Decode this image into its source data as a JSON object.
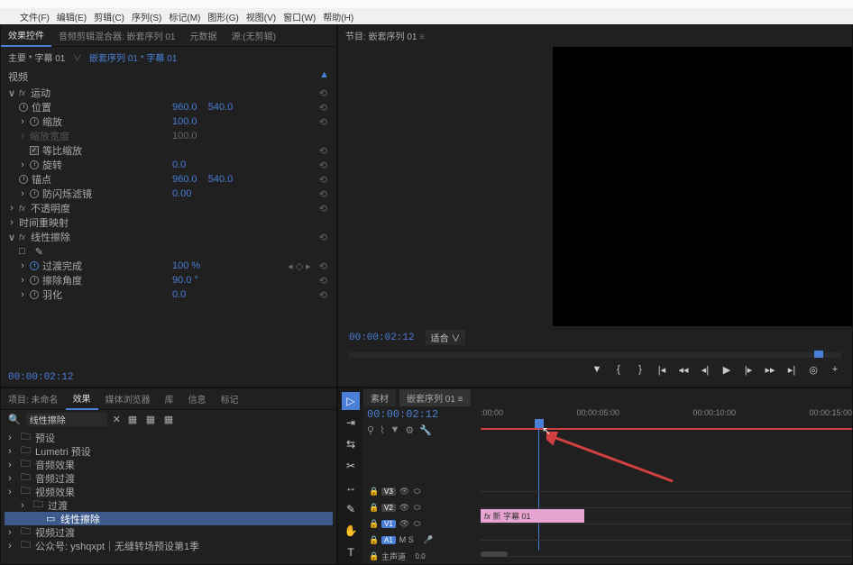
{
  "menu": [
    "文件(F)",
    "编辑(E)",
    "剪辑(C)",
    "序列(S)",
    "标记(M)",
    "图形(G)",
    "视图(V)",
    "窗口(W)",
    "帮助(H)"
  ],
  "effectControls": {
    "tabs": [
      "效果控件",
      "音频剪辑混合器: 嵌套序列 01",
      "元数据",
      "源:(无剪辑)"
    ],
    "activeTab": 0,
    "breadcrumb_main": "主要",
    "breadcrumb_clip": "字幕 01",
    "breadcrumb_seq": "嵌套序列 01 * 字幕 01",
    "header_video": "视频",
    "motion": {
      "label": "运动",
      "position": {
        "label": "位置",
        "x": "960.0",
        "y": "540.0"
      },
      "scale": {
        "label": "缩放",
        "value": "100.0"
      },
      "scaleW": {
        "label": "缩放宽度",
        "value": "100.0"
      },
      "uniform": {
        "label": "等比缩放",
        "checked": true
      },
      "rotation": {
        "label": "旋转",
        "value": "0.0"
      },
      "anchor": {
        "label": "锚点",
        "x": "960.0",
        "y": "540.0"
      },
      "antiflicker": {
        "label": "防闪烁滤镜",
        "value": "0.00"
      }
    },
    "opacity": {
      "label": "不透明度"
    },
    "timeremap": {
      "label": "时间重映射"
    },
    "linearWipe": {
      "label": "线性擦除",
      "box_icon": "□",
      "completion": {
        "label": "过渡完成",
        "value": "100 %"
      },
      "angle": {
        "label": "擦除角度",
        "value": "90.0 °"
      },
      "feather": {
        "label": "羽化",
        "value": "0.0"
      }
    },
    "timecode": "00:00:02:12"
  },
  "program": {
    "title": "节目: 嵌套序列 01",
    "timecode": "00:00:02:12",
    "fit": "适合"
  },
  "project": {
    "tabs": [
      "项目: 未命名",
      "效果",
      "媒体浏览器",
      "库",
      "信息",
      "标记"
    ],
    "activeTab": 1,
    "searchPlaceholder": "线性擦除",
    "folders": [
      {
        "icon": "folder",
        "label": "预设",
        "indent": 0
      },
      {
        "icon": "folder",
        "label": "Lumetri 预设",
        "indent": 0
      },
      {
        "icon": "folder",
        "label": "音频效果",
        "indent": 0
      },
      {
        "icon": "folder",
        "label": "音频过渡",
        "indent": 0
      },
      {
        "icon": "folder",
        "label": "视频效果",
        "indent": 0
      },
      {
        "icon": "folder",
        "label": "过渡",
        "indent": 1
      },
      {
        "icon": "effect",
        "label": "线性擦除",
        "indent": 2,
        "selected": true
      },
      {
        "icon": "folder",
        "label": "视频过渡",
        "indent": 0
      },
      {
        "icon": "folder",
        "label": "公众号: yshqxpt｜无缝转场预设第1季",
        "indent": 0
      }
    ]
  },
  "timeline": {
    "tabs": [
      "素材",
      "嵌套序列 01"
    ],
    "activeTab": 1,
    "timecode": "00:00:02:12",
    "timeMarks": [
      ":00:00",
      "00:00:05:00",
      "00:00:10:00",
      "00:00:15:00"
    ],
    "tracks": {
      "v3": "V3",
      "v2": "V2",
      "v1": "V1",
      "a1": "A1",
      "master": "主声道"
    },
    "clip_label": "新 字幕 01",
    "audio_meters": "M  S"
  },
  "icons": {
    "mic": "🎤"
  }
}
